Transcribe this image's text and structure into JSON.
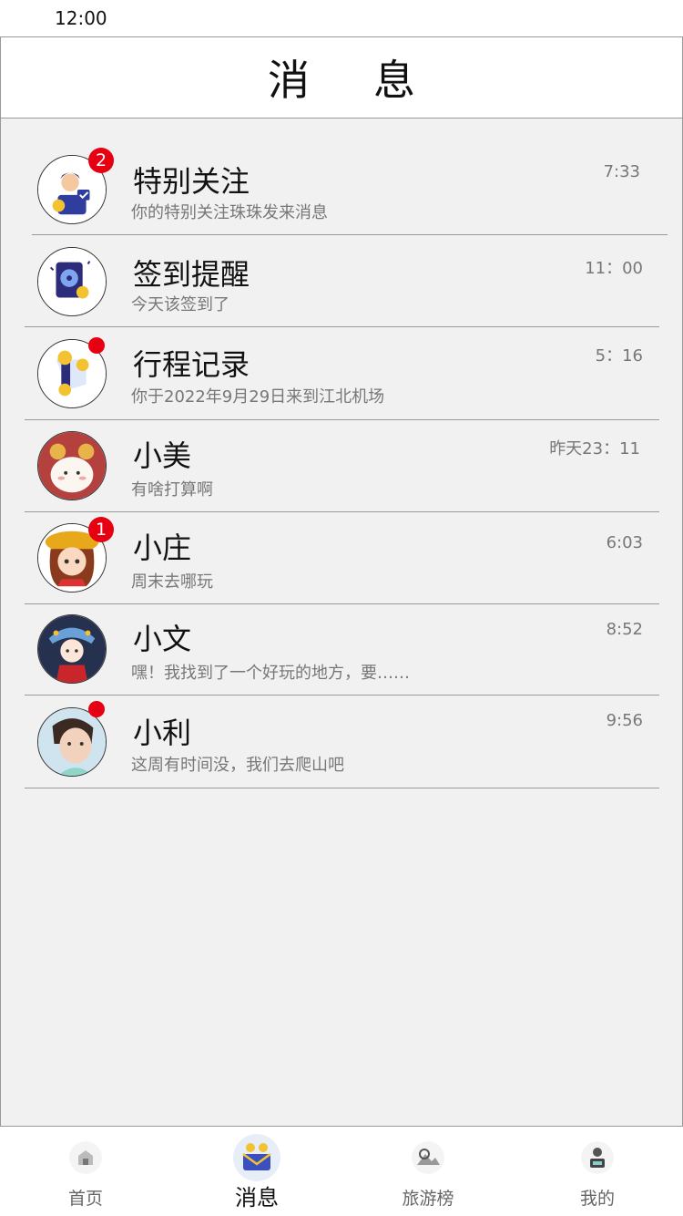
{
  "status_bar": {
    "time": "12:00"
  },
  "header": {
    "title": "消息"
  },
  "messages": [
    {
      "name": "特别关注",
      "preview": "你的特别关注珠珠发来消息",
      "time": "7:33",
      "badge": "2",
      "avatar_icon": "special-follow-icon"
    },
    {
      "name": "签到提醒",
      "preview": "今天该签到了",
      "time": "11：00",
      "badge": "",
      "avatar_icon": "sign-in-icon"
    },
    {
      "name": "行程记录",
      "preview": "你于2022年9月29日来到江北机场",
      "time": "5：16",
      "badge": "dot",
      "avatar_icon": "trip-record-icon"
    },
    {
      "name": "小美",
      "preview": "有啥打算啊",
      "time": "昨天23：11",
      "badge": "",
      "avatar_icon": "bunny-avatar"
    },
    {
      "name": "小庄",
      "preview": "周末去哪玩",
      "time": "6:03",
      "badge": "1",
      "avatar_icon": "girl-hat-avatar"
    },
    {
      "name": "小文",
      "preview": "嘿！我找到了一个好玩的地方，要……",
      "time": "8:52",
      "badge": "",
      "avatar_icon": "opera-avatar"
    },
    {
      "name": "小利",
      "preview": "这周有时间没，我们去爬山吧",
      "time": "9:56",
      "badge": "dot",
      "avatar_icon": "kid-photo-avatar"
    }
  ],
  "tabs": [
    {
      "label": "首页",
      "icon": "home-icon",
      "active": false
    },
    {
      "label": "消息",
      "icon": "message-icon",
      "active": true
    },
    {
      "label": "旅游榜",
      "icon": "travel-rank-icon",
      "active": false
    },
    {
      "label": "我的",
      "icon": "profile-icon",
      "active": false
    }
  ],
  "colors": {
    "badge": "#e60012",
    "background": "#f1f1f1",
    "divider": "#9a9a9a"
  }
}
